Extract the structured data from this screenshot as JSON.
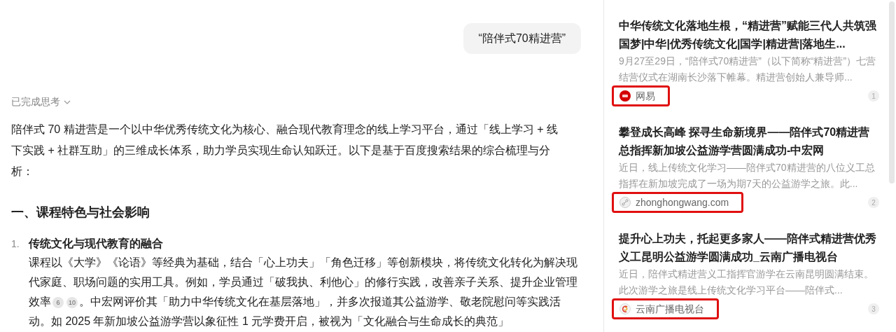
{
  "query_bubble": "“陪伴式70精进营”",
  "thinking_toggle": {
    "label": "已完成思考",
    "expanded": false
  },
  "intro": "陪伴式 70 精进营是一个以中华优秀传统文化为核心、融合现代教育理念的线上学习平台，通过「线上学习 + 线下实践 + 社群互助」的三维成长体系，助力学员实现生命认知跃迁。以下是基于百度搜索结果的综合梳理与分析：",
  "section_heading": "一、课程特色与社会影响",
  "list_items": [
    {
      "marker": "1.",
      "title": "传统文化与现代教育的融合",
      "body": [
        {
          "kind": "text",
          "text": "课程以《大学》《论语》等经典为基础，结合「心上功夫」「角色迁移」等创新模块，将传统文化转化为解决现代家庭、职场问题的实用工具。例如，学员通过「破我执、利他心」的修行实践，改善亲子关系、提升企业管理效率"
        },
        {
          "kind": "cite",
          "text": "6"
        },
        {
          "kind": "cite",
          "text": "10"
        },
        {
          "kind": "text",
          "text": "。中宏网评价其「助力中华传统文化在基层落地」，并多次报道其公益游学、敬老院慰问等实践活动。如 2025 年新加坡公益游学营以象征性 1 元学费开启，被视为「文化融合与生命成长的典范」"
        }
      ]
    }
  ],
  "sources": [
    {
      "title": "中华传统文化落地生根，“精进营”赋能三代人共筑强国梦|中华|优秀传统文化|国学|精进营|落地生...",
      "snippet": "9月27至29日，“陪伴式70精进营”（以下简称“精进营”）七营结营仪式在湖南长沙落下帷幕。精进营创始人兼导师...",
      "source": "网易",
      "kind": "badge",
      "highlighted": true,
      "number": "1"
    },
    {
      "title": "攀登成长高峰 探寻生命新境界——陪伴式70精进营总指挥新加坡公益游学营圆满成功-中宏网",
      "snippet": "近日，线上传统文化学习——陪伴式70精进营的八位义工总指挥在新加坡完成了一场为期7天的公益游学之旅。此...",
      "source": "zhonghongwang.com",
      "kind": "link",
      "highlighted": true,
      "number": "2"
    },
    {
      "title": "提升心上功夫，托起更多家人——陪伴式精进营优秀义工昆明公益游学圆满成功_云南广播电视台",
      "snippet": "近日，陪伴式精进营义工指挥官游学在云南昆明圆满结束。此次游学之旅是线上传统文化学习平台——陪伴式...",
      "source": "云南广播电视台",
      "kind": "swirl",
      "highlighted": true,
      "number": "3"
    }
  ]
}
